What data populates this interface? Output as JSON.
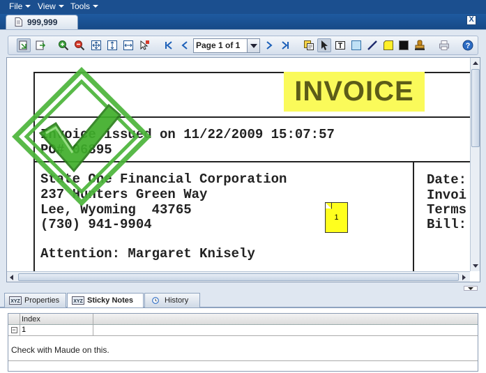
{
  "menu": {
    "items": [
      {
        "label": "File"
      },
      {
        "label": "View"
      },
      {
        "label": "Tools"
      }
    ]
  },
  "document_tab": {
    "label": "999,999",
    "close_label": "X"
  },
  "toolbar": {
    "page_selector": "Page 1 of 1",
    "icons": [
      "pan-icon",
      "select-text-icon",
      "zoom-in-icon",
      "zoom-out-icon",
      "fit-page-icon",
      "fit-height-icon",
      "fit-width-icon",
      "magnify-icon",
      "first-page-icon",
      "previous-page-icon",
      "next-page-icon",
      "last-page-icon",
      "copy-icon",
      "pointer-icon",
      "text-annotation-icon",
      "rectangle-icon",
      "line-icon",
      "sticky-note-icon",
      "redact-icon",
      "stamp-icon",
      "print-icon",
      "help-icon"
    ]
  },
  "document": {
    "invoice_title": "INVOICE",
    "issued_line": "Invoice issued on 11/22/2009 15:07:57",
    "po_line": "PO# 06895",
    "company": "State One Financial Corporation",
    "address1": "237 Hunters Green Way",
    "address2": "Lee, Wyoming  43765",
    "phone": "(730) 941-9904",
    "attention": "Attention: Margaret Knisely",
    "right_labels": [
      "Date:",
      "Invoi",
      "Terms",
      "Bill:"
    ],
    "sticky_marker": "1"
  },
  "bottom_tabs": [
    {
      "label": "Properties"
    },
    {
      "label": "Sticky Notes"
    },
    {
      "label": "History"
    }
  ],
  "notes_grid": {
    "column_header": "Index",
    "rows": [
      {
        "index": "1"
      }
    ],
    "note_text": "Check with Maude on this.",
    "expand_symbol": "−"
  },
  "colors": {
    "menubar": "#1b4f8f",
    "invoice_highlight": "#fafa5a",
    "stamp_green": "#3fae2a",
    "sticky_yellow": "#ffff1e"
  }
}
